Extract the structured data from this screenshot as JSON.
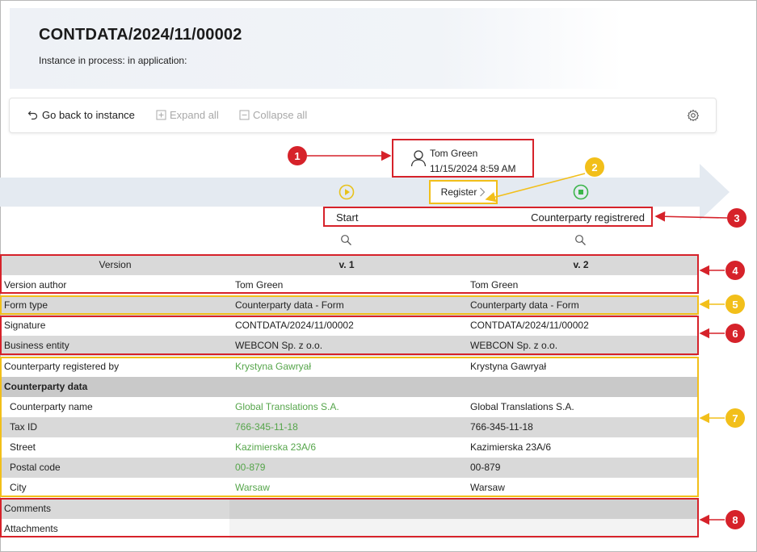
{
  "header": {
    "title": "CONTDATA/2024/11/00002",
    "subtitle": "Instance in process: in application:"
  },
  "toolbar": {
    "back_label": "Go back to instance",
    "expand_label": "Expand all",
    "collapse_label": "Collapse all"
  },
  "history": {
    "user": "Tom Green",
    "date": "11/15/2024 8:59 AM",
    "action": "Register",
    "step_start": "Start",
    "step_end": "Counterparty registrered"
  },
  "table": {
    "header": {
      "label": "Version",
      "v1": "v. 1",
      "v2": "v. 2"
    },
    "rows": [
      {
        "label": "Version author",
        "v1": "Tom Green",
        "v2": "Tom Green"
      },
      {
        "label": "Form type",
        "v1": "Counterparty data - Form",
        "v2": "Counterparty data - Form"
      },
      {
        "label": "Signature",
        "v1": "CONTDATA/2024/11/00002",
        "v2": "CONTDATA/2024/11/00002"
      },
      {
        "label": "Business entity",
        "v1": "WEBCON Sp. z o.o.",
        "v2": "WEBCON Sp. z o.o."
      },
      {
        "label": "Counterparty registered by",
        "v1": "Krystyna Gawryał",
        "v2": "Krystyna Gawryał"
      },
      {
        "label": "Counterparty data",
        "v1": "",
        "v2": ""
      },
      {
        "label": "Counterparty name",
        "v1": "Global Translations S.A.",
        "v2": "Global Translations S.A."
      },
      {
        "label": "Tax ID",
        "v1": "766-345-11-18",
        "v2": "766-345-11-18"
      },
      {
        "label": "Street",
        "v1": "Kazimierska 23A/6",
        "v2": "Kazimierska 23A/6"
      },
      {
        "label": "Postal code",
        "v1": "00-879",
        "v2": "00-879"
      },
      {
        "label": "City",
        "v1": "Warsaw",
        "v2": "Warsaw"
      },
      {
        "label": "Comments",
        "v1": "",
        "v2": ""
      },
      {
        "label": "Attachments",
        "v1": "",
        "v2": ""
      }
    ]
  },
  "badges": [
    "1",
    "2",
    "3",
    "4",
    "5",
    "6",
    "7",
    "8"
  ],
  "colors": {
    "annotation_red": "#d6222a",
    "annotation_yellow": "#f2bf1a",
    "changed_value_green": "#55a54a",
    "step_icon_yellow": "#e8c21c",
    "step_icon_green": "#3bb54a"
  }
}
